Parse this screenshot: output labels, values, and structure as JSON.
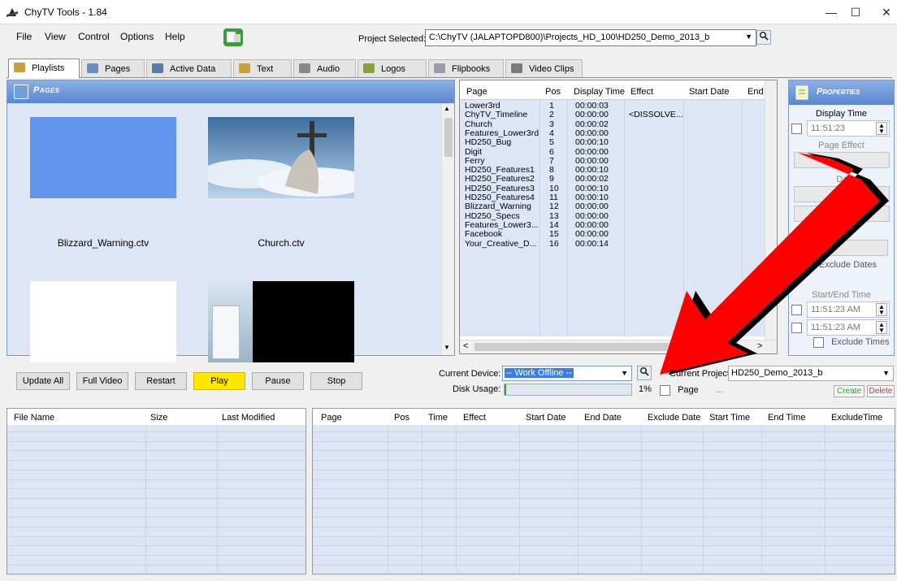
{
  "window": {
    "title": "ChyTV Tools - 1.84",
    "minimize": "—",
    "maximize": "☐",
    "close": "✕"
  },
  "menu": [
    "File",
    "View",
    "Control",
    "Options",
    "Help"
  ],
  "project": {
    "label": "Project Selected:",
    "path": "C:\\ChyTV (JALAPTOPD800)\\Projects_HD_100\\HD250_Demo_2013_b"
  },
  "tabs": [
    {
      "label": "Playlists",
      "icon": "playlist-icon",
      "color": "#c8a040"
    },
    {
      "label": "Pages",
      "icon": "page-icon",
      "color": "#6a8fbf"
    },
    {
      "label": "Active Data",
      "icon": "database-icon",
      "color": "#5a7aa8"
    },
    {
      "label": "Text",
      "icon": "text-icon",
      "color": "#c8a040"
    },
    {
      "label": "Audio",
      "icon": "audio-icon",
      "color": "#888888"
    },
    {
      "label": "Logos",
      "icon": "logo-icon",
      "color": "#8aa040"
    },
    {
      "label": "Flipbooks",
      "icon": "flipbook-icon",
      "color": "#9a9ab0"
    },
    {
      "label": "Video Clips",
      "icon": "video-icon",
      "color": "#7a7a7a"
    }
  ],
  "pages_panel": {
    "title": "Pages",
    "thumbnails": [
      {
        "label": "Blizzard_Warning.ctv"
      },
      {
        "label": "Church.ctv"
      },
      {
        "label": ""
      },
      {
        "label": ""
      }
    ]
  },
  "playlist": {
    "columns": [
      "Page",
      "Pos",
      "Display Time",
      "Effect",
      "Start Date",
      "End Date"
    ],
    "rows": [
      {
        "page": "Lower3rd",
        "pos": "1",
        "time": "00:00:03",
        "effect": ""
      },
      {
        "page": "ChyTV_Timeline",
        "pos": "2",
        "time": "00:00:00",
        "effect": "<DISSOLVE..."
      },
      {
        "page": "Church",
        "pos": "3",
        "time": "00:00:02",
        "effect": ""
      },
      {
        "page": "Features_Lower3rd",
        "pos": "4",
        "time": "00:00:00",
        "effect": ""
      },
      {
        "page": "HD250_Bug",
        "pos": "5",
        "time": "00:00:10",
        "effect": ""
      },
      {
        "page": "Digit",
        "pos": "6",
        "time": "00:00:00",
        "effect": ""
      },
      {
        "page": "Ferry",
        "pos": "7",
        "time": "00:00:00",
        "effect": ""
      },
      {
        "page": "HD250_Features1",
        "pos": "8",
        "time": "00:00:10",
        "effect": ""
      },
      {
        "page": "HD250_Features2",
        "pos": "9",
        "time": "00:00:02",
        "effect": ""
      },
      {
        "page": "HD250_Features3",
        "pos": "10",
        "time": "00:00:10",
        "effect": ""
      },
      {
        "page": "HD250_Features4",
        "pos": "11",
        "time": "00:00:10",
        "effect": ""
      },
      {
        "page": "Blizzard_Warning",
        "pos": "12",
        "time": "00:00:00",
        "effect": ""
      },
      {
        "page": "HD250_Specs",
        "pos": "13",
        "time": "00:00:00",
        "effect": ""
      },
      {
        "page": "Features_Lower3...",
        "pos": "14",
        "time": "00:00:00",
        "effect": ""
      },
      {
        "page": "Facebook",
        "pos": "15",
        "time": "00:00:00",
        "effect": ""
      },
      {
        "page": "Your_Creative_D...",
        "pos": "16",
        "time": "00:00:14",
        "effect": ""
      }
    ]
  },
  "properties": {
    "title": "Properties",
    "display_time_label": "Display Time",
    "display_time": "11:51:23",
    "page_effect_label": "Page Effect",
    "date_label": "Date",
    "exclude_dates": "Exclude Dates",
    "start_end_time_label": "Start/End Time",
    "start_time": "11:51:23 AM",
    "end_time": "11:51:23 AM",
    "exclude_times": "Exclude Times"
  },
  "controls": {
    "update_all": "Update All",
    "full_video": "Full Video",
    "restart": "Restart",
    "play": "Play",
    "pause": "Pause",
    "stop": "Stop"
  },
  "device": {
    "label": "Current Device:",
    "value": "-- Work Offline --",
    "disk_label": "Disk Usage:",
    "disk_percent": "1%",
    "disk_fraction": 0.01,
    "page_checkbox": "Page",
    "ellipsis": "...",
    "current_project_label": "Current Project:",
    "current_project": "HD250_Demo_2013_b",
    "create": "Create",
    "delete": "Delete"
  },
  "files_table": {
    "columns": [
      "File Name",
      "Size",
      "Last Modified"
    ]
  },
  "detail_table": {
    "columns": [
      "Page",
      "Pos",
      "Time",
      "Effect",
      "Start Date",
      "End Date",
      "Exclude Date",
      "Start Time",
      "End Time",
      "ExcludeTime"
    ]
  },
  "colors": {
    "accent": "#5a86cf",
    "arrow": "#ff0000",
    "play": "#ffe600",
    "grid_bg": "#dce6f5",
    "delete": "#e03030",
    "create": "#2aa02a"
  }
}
